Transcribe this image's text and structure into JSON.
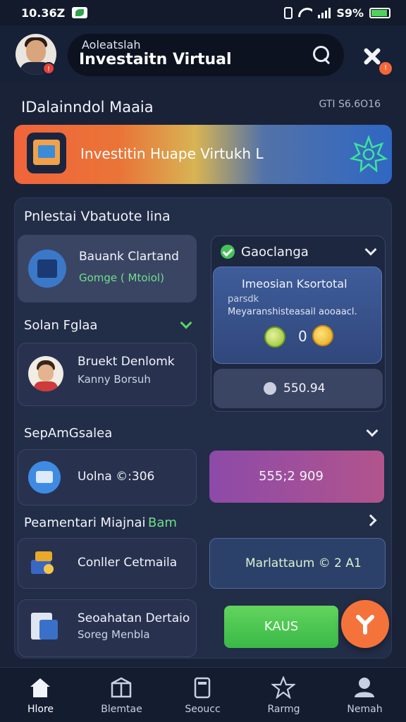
{
  "status_bar": {
    "time": "10.36Z",
    "battery": "S9%"
  },
  "header": {
    "search_small": "Aoleatslah",
    "search_title": "Investaitn Virtual",
    "avatar_badge": "!",
    "tools_badge": "!"
  },
  "section": {
    "title": "IDalainndol Maaia",
    "meta": "GTI S6.6O16"
  },
  "banner": {
    "text": "Investitin Huape Virtukh L"
  },
  "panel": {
    "title": "Pnlestai Vbatuote lina",
    "card1": {
      "title": "Bauank Clartand",
      "subtitle": "Gomge ( Mtoiol)"
    },
    "subheading1": "Solan Fglaa",
    "card2": {
      "title": "Bruekt Denlomk",
      "subtitle": "Kanny Borsuh"
    },
    "right_header": "Gaoclanga",
    "bluecard": {
      "title": "Imeosian Ksortotal",
      "line1": "parsdk",
      "line2": "Meyaranshisteasail aooaacl.",
      "coin_value": "0"
    },
    "value_card": "550.94",
    "subheading2": "SepAmGsalea",
    "card3": {
      "label": "Uolna ©:306"
    },
    "purple_value": "555;2 909",
    "subheading3": "Peamentari Miajnai",
    "subheading3_green": "Bam",
    "card4": {
      "label": "Conller Cetmaila"
    },
    "navy_value": "Marlattaum © 2 A1",
    "card5": {
      "title": "Seoahatan Dertaio",
      "subtitle": "Soreg Menbla"
    },
    "green_button": "KAUS"
  },
  "bottom_nav": [
    {
      "label": "Hlore",
      "icon": "home-icon"
    },
    {
      "label": "Blemtae",
      "icon": "box-icon"
    },
    {
      "label": "Seoucc",
      "icon": "wallet-icon"
    },
    {
      "label": "Rarmg",
      "icon": "star-icon"
    },
    {
      "label": "Nemah",
      "icon": "profile-icon"
    }
  ],
  "colors": {
    "background": "#1a2238",
    "accent_orange": "#f4733a",
    "accent_green": "#45c259",
    "accent_purple": "#a24f9a",
    "accent_blue": "#3f5d9b"
  }
}
